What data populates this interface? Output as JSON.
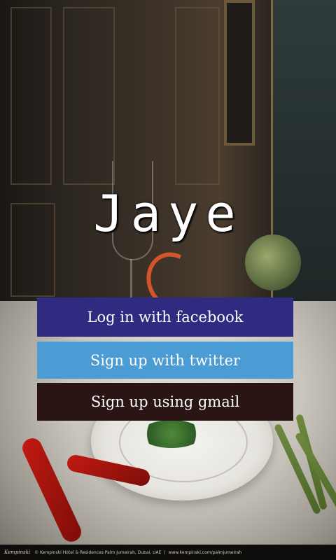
{
  "app": {
    "title": "Jaye"
  },
  "buttons": {
    "facebook": "Log in with facebook",
    "twitter": "Sign up with twitter",
    "gmail": "Sign up using gmail"
  },
  "footer": {
    "brand": "Kempinski",
    "address": "© Kempinski Hotel & Residences Palm Jumeirah, Dubai, UAE",
    "separator": "|",
    "website": "www.kempinski.com/palmjumeirah"
  },
  "colors": {
    "facebook": "#2e2b80",
    "twitter": "#4b9bd5",
    "gmail": "#2a1414",
    "title_text": "#ffffff"
  },
  "background": {
    "icon": "restaurant-table-photo"
  }
}
